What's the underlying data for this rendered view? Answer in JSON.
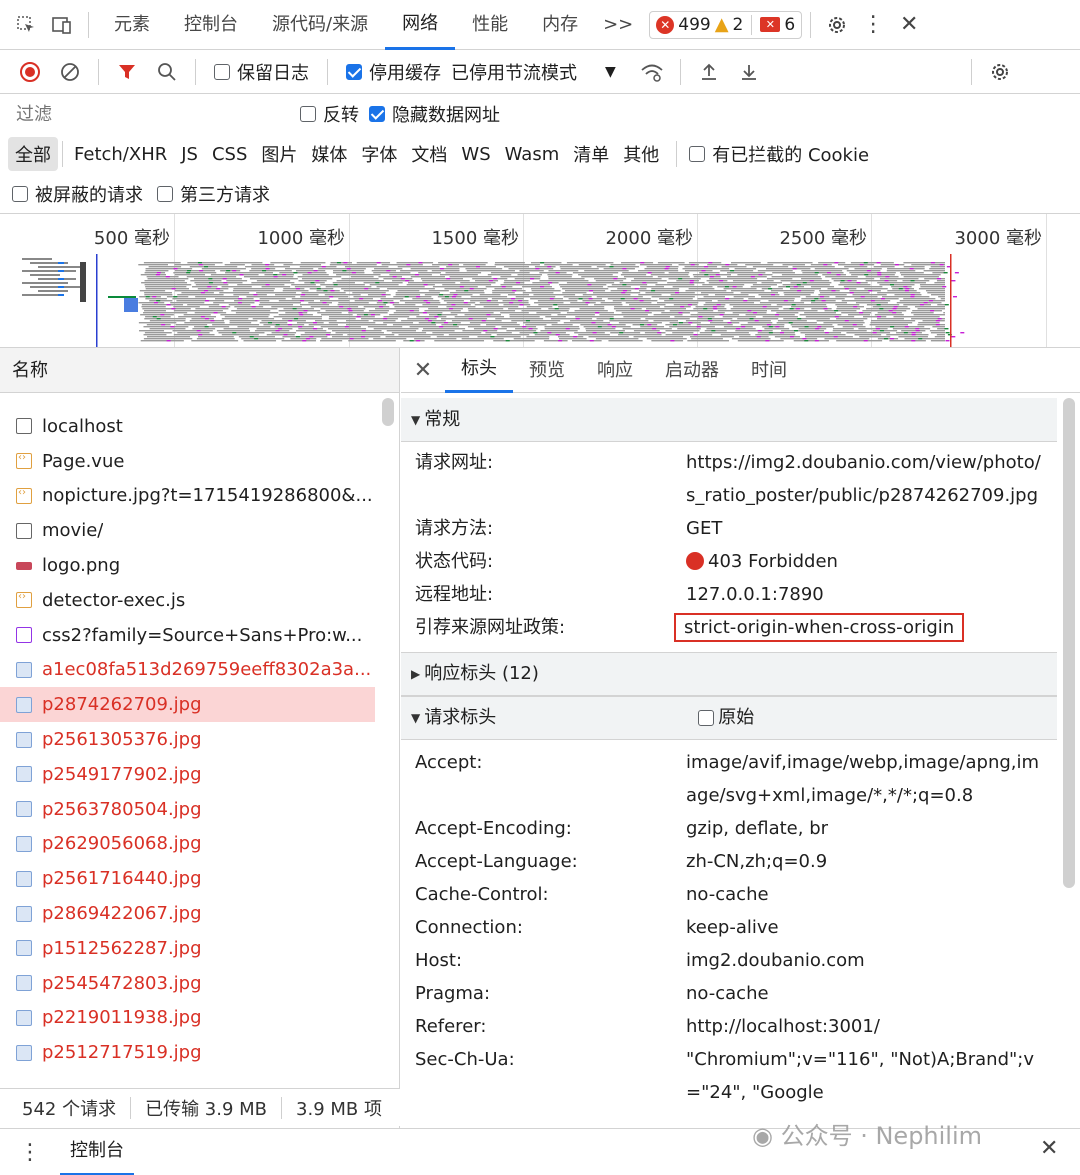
{
  "topbar": {
    "tabs": [
      "元素",
      "控制台",
      "源代码/来源",
      "网络",
      "性能",
      "内存"
    ],
    "more": ">>",
    "errors": "499",
    "warnings": "2",
    "messages": "6"
  },
  "toolbar": {
    "preserve_log": "保留日志",
    "disable_cache": "停用缓存",
    "throttle": "已停用节流模式"
  },
  "filter": {
    "placeholder": "过滤",
    "invert": "反转",
    "hide_data_urls": "隐藏数据网址"
  },
  "types": [
    "全部",
    "Fetch/XHR",
    "JS",
    "CSS",
    "图片",
    "媒体",
    "字体",
    "文档",
    "WS",
    "Wasm",
    "清单",
    "其他"
  ],
  "blocked_cookies": "有已拦截的 Cookie",
  "blocked_requests": "被屏蔽的请求",
  "third_party": "第三方请求",
  "timeline": {
    "ticks": [
      "500 毫秒",
      "1000 毫秒",
      "1500 毫秒",
      "2000 毫秒",
      "2500 毫秒",
      "3000 毫秒"
    ]
  },
  "list": {
    "header": "名称",
    "rows": [
      {
        "name": "localhost",
        "icon": "doc",
        "error": false
      },
      {
        "name": "Page.vue",
        "icon": "script",
        "error": false
      },
      {
        "name": "nopicture.jpg?t=1715419286800&...",
        "icon": "script",
        "error": false
      },
      {
        "name": "movie/",
        "icon": "doc",
        "error": false
      },
      {
        "name": "logo.png",
        "icon": "png",
        "error": false
      },
      {
        "name": "detector-exec.js",
        "icon": "script",
        "error": false
      },
      {
        "name": "css2?family=Source+Sans+Pro:w...",
        "icon": "css",
        "error": false
      },
      {
        "name": "a1ec08fa513d269759eeff8302a3a...",
        "icon": "img",
        "error": true
      },
      {
        "name": "p2874262709.jpg",
        "icon": "img",
        "error": true,
        "selected": true
      },
      {
        "name": "p2561305376.jpg",
        "icon": "img",
        "error": true
      },
      {
        "name": "p2549177902.jpg",
        "icon": "img",
        "error": true
      },
      {
        "name": "p2563780504.jpg",
        "icon": "img",
        "error": true
      },
      {
        "name": "p2629056068.jpg",
        "icon": "img",
        "error": true
      },
      {
        "name": "p2561716440.jpg",
        "icon": "img",
        "error": true
      },
      {
        "name": "p2869422067.jpg",
        "icon": "img",
        "error": true
      },
      {
        "name": "p1512562287.jpg",
        "icon": "img",
        "error": true
      },
      {
        "name": "p2545472803.jpg",
        "icon": "img",
        "error": true
      },
      {
        "name": "p2219011938.jpg",
        "icon": "img",
        "error": true
      },
      {
        "name": "p2512717519.jpg",
        "icon": "img",
        "error": true
      }
    ],
    "status_requests": "542 个请求",
    "status_transferred": "已传输 3.9 MB",
    "status_resources": "3.9 MB 项"
  },
  "details": {
    "tabs": [
      "标头",
      "预览",
      "响应",
      "启动器",
      "时间"
    ],
    "general_title": "常规",
    "general": [
      {
        "k": "请求网址:",
        "v": "https://img2.doubanio.com/view/photo/s_ratio_poster/public/p2874262709.jpg"
      },
      {
        "k": "请求方法:",
        "v": "GET"
      },
      {
        "k": "状态代码:",
        "v": "403 Forbidden"
      },
      {
        "k": "远程地址:",
        "v": "127.0.0.1:7890"
      },
      {
        "k": "引荐来源网址政策:",
        "v": "strict-origin-when-cross-origin"
      }
    ],
    "response_headers": "响应标头 (12)",
    "request_headers": "请求标头",
    "raw": "原始",
    "req": [
      {
        "k": "Accept:",
        "v": "image/avif,image/webp,image/apng,image/svg+xml,image/*,*/*;q=0.8"
      },
      {
        "k": "Accept-Encoding:",
        "v": "gzip, deflate, br"
      },
      {
        "k": "Accept-Language:",
        "v": "zh-CN,zh;q=0.9"
      },
      {
        "k": "Cache-Control:",
        "v": "no-cache"
      },
      {
        "k": "Connection:",
        "v": "keep-alive"
      },
      {
        "k": "Host:",
        "v": "img2.doubanio.com"
      },
      {
        "k": "Pragma:",
        "v": "no-cache"
      },
      {
        "k": "Referer:",
        "v": "http://localhost:3001/"
      },
      {
        "k": "Sec-Ch-Ua:",
        "v": "\"Chromium\";v=\"116\", \"Not)A;Brand\";v=\"24\", \"Google"
      }
    ]
  },
  "drawer": {
    "console_tab": "控制台",
    "watermark": "公众号 · Nephilim"
  }
}
